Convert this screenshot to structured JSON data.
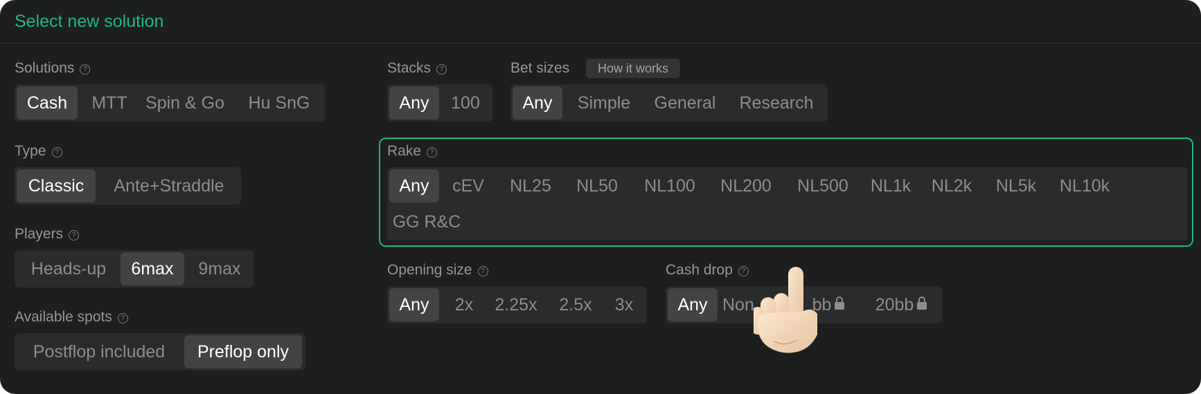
{
  "title": "Select new solution",
  "solutions": {
    "label": "Solutions",
    "options": [
      "Cash",
      "MTT",
      "Spin & Go",
      "Hu SnG"
    ],
    "selected": "Cash"
  },
  "type": {
    "label": "Type",
    "options": [
      "Classic",
      "Ante+Straddle"
    ],
    "selected": "Classic"
  },
  "players": {
    "label": "Players",
    "options": [
      "Heads-up",
      "6max",
      "9max"
    ],
    "selected": "6max"
  },
  "available_spots": {
    "label": "Available spots",
    "options": [
      "Postflop included",
      "Preflop only"
    ],
    "selected": "Preflop only"
  },
  "stacks": {
    "label": "Stacks",
    "options": [
      "Any",
      "100"
    ],
    "selected": "Any"
  },
  "bet_sizes": {
    "label": "Bet sizes",
    "how_it_works": "How it works",
    "options": [
      "Any",
      "Simple",
      "General",
      "Research"
    ],
    "selected": "Any"
  },
  "rake": {
    "label": "Rake",
    "options": [
      "Any",
      "cEV",
      "NL25",
      "NL50",
      "NL100",
      "NL200",
      "NL500",
      "NL1k",
      "NL2k",
      "NL5k",
      "NL10k",
      "GG R&C"
    ],
    "selected": "Any"
  },
  "opening_size": {
    "label": "Opening size",
    "options": [
      "Any",
      "2x",
      "2.25x",
      "2.5x",
      "3x"
    ],
    "selected": "Any"
  },
  "cash_drop": {
    "label": "Cash drop",
    "options": [
      "Any",
      "Non",
      "bb",
      "20bb"
    ],
    "locked": [
      "bb",
      "20bb"
    ],
    "selected": "Any"
  },
  "icons": {
    "help": "question-circle-icon",
    "lock": "lock-icon",
    "cursor": "pointing-hand-icon"
  },
  "colors": {
    "accent": "#1fb889",
    "panel": "#1d1e1e",
    "chip": "#2a2b2b",
    "selected": "#424444"
  }
}
